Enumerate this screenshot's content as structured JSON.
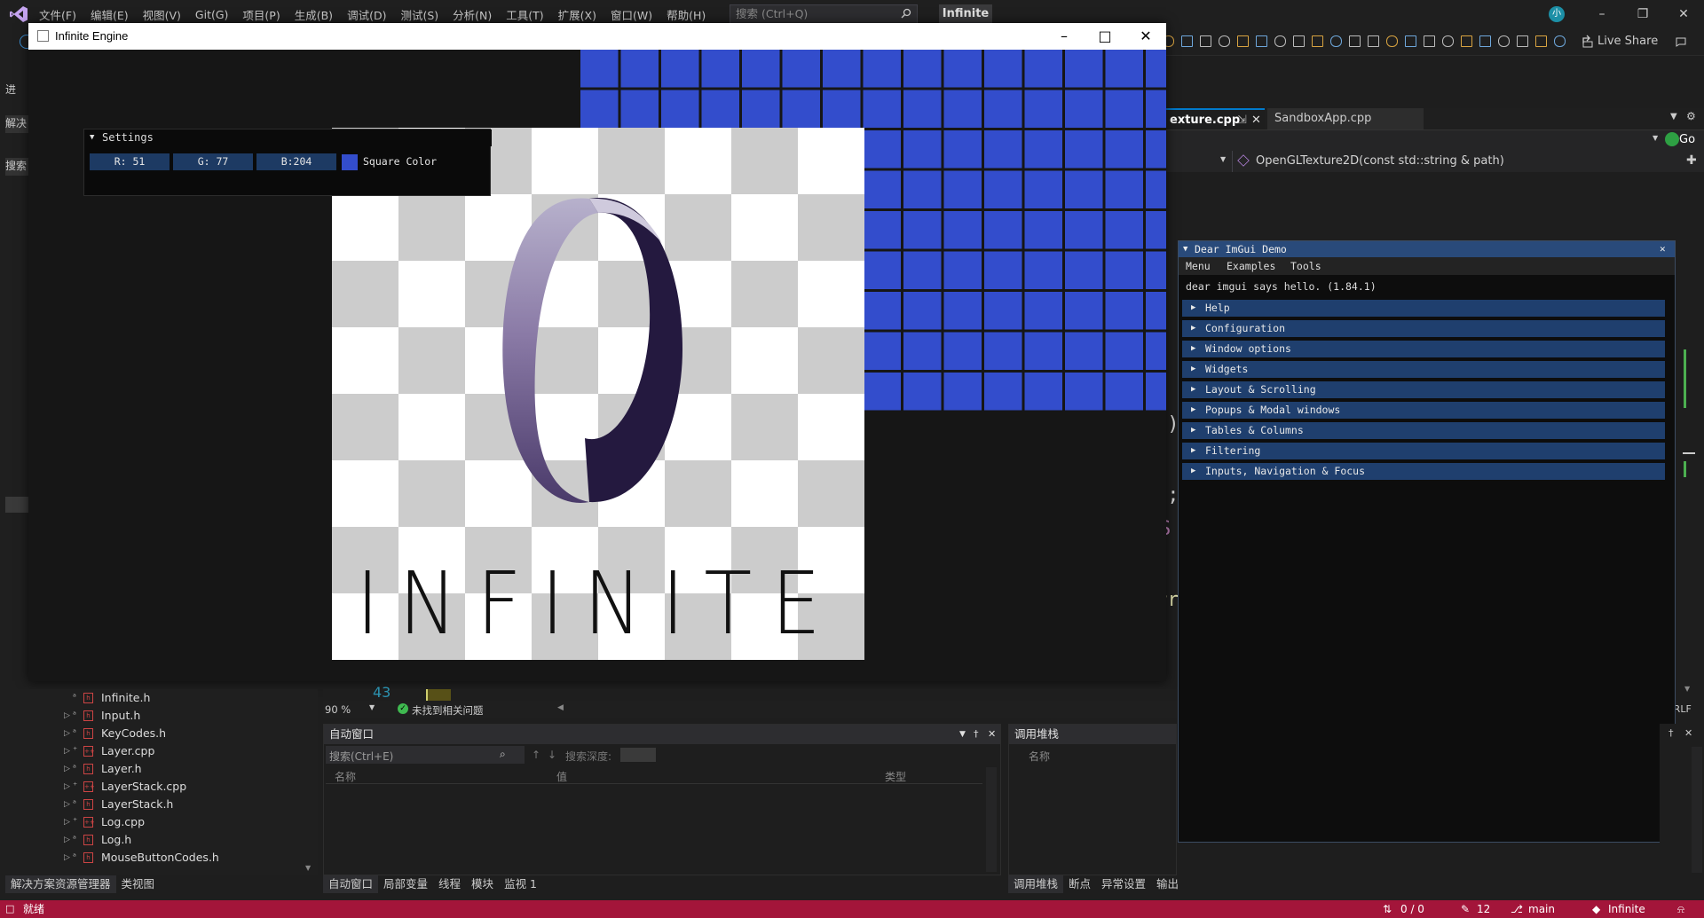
{
  "vs": {
    "menu": [
      "文件(F)",
      "编辑(E)",
      "视图(V)",
      "Git(G)",
      "项目(P)",
      "生成(B)",
      "调试(D)",
      "测试(S)",
      "分析(N)",
      "工具(T)",
      "扩展(X)",
      "窗口(W)",
      "帮助(H)"
    ],
    "search_placeholder": "搜索 (Ctrl+Q)",
    "solution_name": "Infinite",
    "account_initials": "小",
    "live_share": "Live Share",
    "go_label": "Go"
  },
  "left_strip": [
    "解决",
    "搜索",
    "进"
  ],
  "editor": {
    "tabs": [
      {
        "label": "exture.cpp",
        "active": true
      },
      {
        "label": "SandboxApp.cpp",
        "active": false
      }
    ],
    "nav_function": "OpenGLTexture2D(const std::string & path)",
    "code_fragments": [
      "t)",
      ");",
      "S",
      "rr",
      "\""
    ]
  },
  "engine": {
    "title": "Infinite Engine",
    "logo_text": "INFINITE",
    "square_color_hex": "#334dcc",
    "checker_light": "#ffffff",
    "checker_dark": "#cccccc"
  },
  "settings": {
    "title": "Settings",
    "r_label": "R: 51",
    "g_label": "G: 77",
    "b_label": "B:204",
    "color_label": "Square Color"
  },
  "imgui_demo": {
    "title": "Dear ImGui Demo",
    "menus": [
      "Menu",
      "Examples",
      "Tools"
    ],
    "hello": "dear imgui says hello. (1.84.1)",
    "sections": [
      "Help",
      "Configuration",
      "Window options",
      "Widgets",
      "Layout & Scrolling",
      "Popups & Modal windows",
      "Tables & Columns",
      "Filtering",
      "Inputs, Navigation & Focus"
    ]
  },
  "solution_explorer": {
    "files": [
      {
        "name": "Infinite.h",
        "type": "h",
        "expandable": false
      },
      {
        "name": "Input.h",
        "type": "h",
        "expandable": true
      },
      {
        "name": "KeyCodes.h",
        "type": "h",
        "expandable": true
      },
      {
        "name": "Layer.cpp",
        "type": "cpp",
        "expandable": true
      },
      {
        "name": "Layer.h",
        "type": "h",
        "expandable": true
      },
      {
        "name": "LayerStack.cpp",
        "type": "cpp",
        "expandable": true
      },
      {
        "name": "LayerStack.h",
        "type": "h",
        "expandable": true
      },
      {
        "name": "Log.cpp",
        "type": "cpp",
        "expandable": true
      },
      {
        "name": "Log.h",
        "type": "h",
        "expandable": true
      },
      {
        "name": "MouseButtonCodes.h",
        "type": "h",
        "expandable": true
      }
    ],
    "tabs": [
      "解决方案资源管理器",
      "类视图"
    ]
  },
  "zoom": {
    "level": "90 %",
    "issues": "未找到相关问题"
  },
  "autos": {
    "title": "自动窗口",
    "search_placeholder": "搜索(Ctrl+E)",
    "search_depth_label": "搜索深度:",
    "columns": [
      "名称",
      "值",
      "类型"
    ],
    "tabs": [
      "自动窗口",
      "局部变量",
      "线程",
      "模块",
      "监视 1"
    ]
  },
  "callstack": {
    "title": "调用堆栈",
    "columns": [
      "名称"
    ],
    "tabs": [
      "调用堆栈",
      "断点",
      "异常设置",
      "输出"
    ]
  },
  "line_number": "43",
  "crlf": "CRLF",
  "status": {
    "ready": "就绪",
    "changes": "0 / 0",
    "pencil_count": "12",
    "branch": "main",
    "repo": "Infinite"
  }
}
